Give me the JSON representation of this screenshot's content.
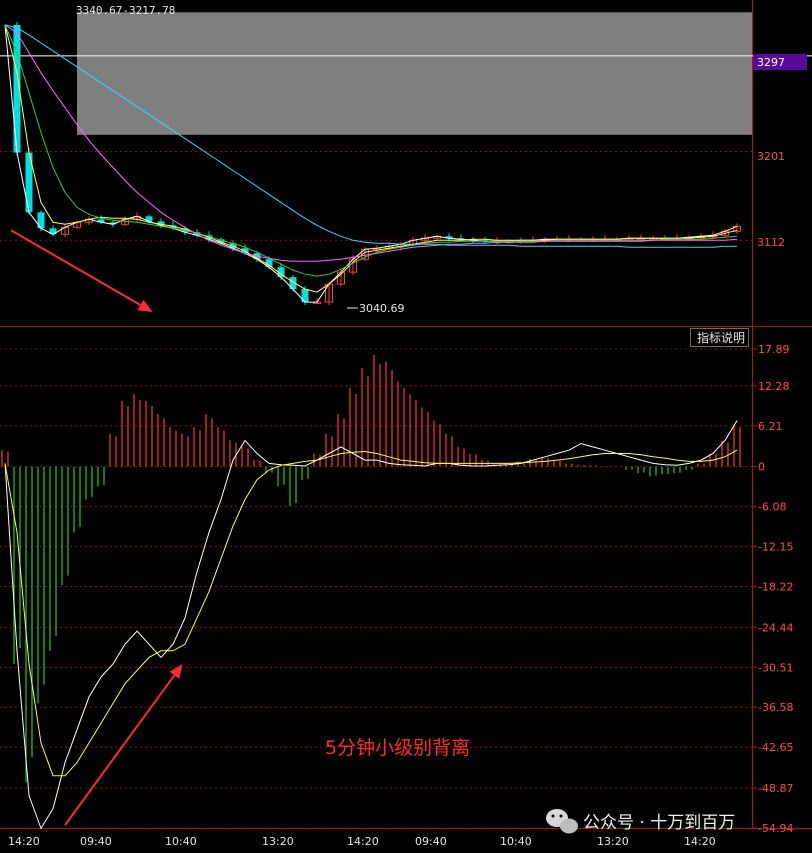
{
  "chart_data": [
    {
      "type": "candlestick",
      "range_label": "3340.67-3217.78",
      "price_marker": "3297",
      "low_label": "3040.69",
      "y_tick_labels": [
        "3201",
        "3112"
      ],
      "ylim": [
        3030,
        3345
      ],
      "highlight_zone": [
        3217.78,
        3340.67
      ],
      "marked_price": 3297,
      "series": [
        {
          "name": "",
          "color": "#ffffff",
          "values": [
            3328,
            3200,
            3140,
            3124,
            3118,
            3125,
            3130,
            3133,
            3130,
            3128,
            3133,
            3136,
            3131,
            3127,
            3124,
            3120,
            3117,
            3113,
            3109,
            3104,
            3099,
            3093,
            3085,
            3075,
            3063,
            3050,
            3050,
            3068,
            3080,
            3093,
            3103,
            3104,
            3106,
            3108,
            3112,
            3114,
            3116,
            3114,
            3113,
            3112,
            3111,
            3111,
            3111,
            3112,
            3112,
            3113,
            3113,
            3113,
            3113,
            3113,
            3113,
            3113,
            3114,
            3114,
            3114,
            3114,
            3114,
            3115,
            3116,
            3117,
            3121,
            3126
          ]
        },
        {
          "name": "",
          "color": "#ffff40",
          "values": [
            3328,
            3280,
            3200,
            3150,
            3130,
            3128,
            3130,
            3133,
            3135,
            3134,
            3134,
            3133,
            3130,
            3128,
            3126,
            3123,
            3119,
            3115,
            3110,
            3106,
            3101,
            3094,
            3087,
            3078,
            3070,
            3063,
            3060,
            3068,
            3078,
            3090,
            3100,
            3102,
            3104,
            3106,
            3108,
            3110,
            3112,
            3112,
            3112,
            3113,
            3113,
            3112,
            3112,
            3112,
            3112,
            3112,
            3113,
            3113,
            3113,
            3113,
            3113,
            3113,
            3114,
            3114,
            3114,
            3114,
            3114,
            3114,
            3115,
            3116,
            3119,
            3122
          ]
        },
        {
          "name": "",
          "color": "#33cc33",
          "values": [
            3328,
            3300,
            3260,
            3220,
            3185,
            3160,
            3145,
            3138,
            3134,
            3132,
            3131,
            3130,
            3128,
            3126,
            3124,
            3122,
            3119,
            3116,
            3112,
            3109,
            3105,
            3100,
            3094,
            3088,
            3082,
            3078,
            3076,
            3078,
            3083,
            3089,
            3095,
            3100,
            3103,
            3105,
            3107,
            3109,
            3110,
            3110,
            3111,
            3111,
            3111,
            3111,
            3111,
            3111,
            3111,
            3111,
            3112,
            3112,
            3112,
            3112,
            3112,
            3112,
            3112,
            3112,
            3112,
            3113,
            3113,
            3113,
            3113,
            3114,
            3115,
            3116
          ]
        },
        {
          "name": "",
          "color": "#ff66ff",
          "values": [
            3328,
            3320,
            3300,
            3280,
            3262,
            3245,
            3228,
            3212,
            3198,
            3185,
            3172,
            3160,
            3150,
            3140,
            3132,
            3125,
            3118,
            3112,
            3107,
            3103,
            3099,
            3096,
            3094,
            3092,
            3091,
            3091,
            3091,
            3092,
            3093,
            3095,
            3097,
            3099,
            3101,
            3103,
            3105,
            3106,
            3107,
            3108,
            3108,
            3109,
            3109,
            3110,
            3110,
            3110,
            3110,
            3111,
            3111,
            3111,
            3111,
            3111,
            3111,
            3111,
            3111,
            3111,
            3112,
            3112,
            3112,
            3112,
            3112,
            3112,
            3112,
            3113
          ]
        },
        {
          "name": "",
          "color": "#33d6ff",
          "values": [
            3328,
            3325,
            3318,
            3310,
            3302,
            3294,
            3286,
            3278,
            3270,
            3262,
            3254,
            3246,
            3238,
            3230,
            3222,
            3214,
            3206,
            3198,
            3190,
            3182,
            3174,
            3166,
            3158,
            3150,
            3142,
            3134,
            3127,
            3121,
            3116,
            3112,
            3110,
            3109,
            3109,
            3108,
            3108,
            3108,
            3108,
            3107,
            3107,
            3107,
            3107,
            3107,
            3107,
            3106,
            3106,
            3106,
            3106,
            3106,
            3106,
            3106,
            3106,
            3106,
            3105,
            3105,
            3105,
            3105,
            3105,
            3105,
            3105,
            3105,
            3106,
            3106
          ]
        }
      ],
      "annotations": [
        {
          "type": "arrow",
          "color": "#ff2a2a",
          "from": [
            0.5,
            3122
          ],
          "to": [
            12.3,
            3040
          ]
        }
      ]
    },
    {
      "type": "macd",
      "button_label": "指标说明",
      "y_tick_labels": [
        "17.89",
        "12.28",
        "6.21",
        "0",
        "-6.08",
        "-12.15",
        "-18.22",
        "-24.44",
        "-30.51",
        "-36.58",
        "-42.65",
        "-48.87",
        "-54.94"
      ],
      "ylim": [
        -54.94,
        17.89
      ],
      "histogram": [
        2.5,
        -30,
        -48,
        -36,
        -28,
        -18,
        -10,
        -5,
        -3,
        5,
        10,
        11,
        10,
        8,
        6,
        5,
        6,
        8,
        6,
        4,
        3,
        1,
        -1,
        -3,
        -6,
        -2,
        2,
        5,
        8,
        12,
        15,
        17,
        16,
        13,
        11,
        9,
        7,
        5,
        3,
        2,
        1,
        0.5,
        0.5,
        0.8,
        1.2,
        1.5,
        1,
        0.5,
        0.3,
        0.2,
        0.1,
        0,
        -0.5,
        -1,
        -1.5,
        -1.2,
        -1,
        -0.5,
        0.5,
        2,
        4,
        6.5
      ],
      "series": [
        {
          "name": "",
          "color": "#ffffff",
          "values": [
            0.5,
            -28,
            -50,
            -55,
            -52,
            -45,
            -40,
            -35,
            -32,
            -30,
            -27,
            -25,
            -27,
            -29,
            -27,
            -23,
            -16,
            -10,
            -5,
            1,
            4,
            2,
            0.5,
            0.3,
            0.2,
            0.1,
            1,
            2,
            3,
            2,
            1,
            1,
            0.5,
            0.3,
            0.2,
            0.1,
            0.5,
            0.5,
            0.2,
            0.1,
            0.1,
            0.2,
            0.3,
            0.5,
            1,
            1.5,
            2,
            2.5,
            3.5,
            3,
            2.5,
            2,
            1.5,
            1,
            0.5,
            0.3,
            0.2,
            0.5,
            1,
            2,
            4,
            7
          ]
        },
        {
          "name": "",
          "color": "#ffff40",
          "values": [
            0.5,
            -10,
            -30,
            -42,
            -47,
            -47,
            -45,
            -42,
            -39,
            -36,
            -33,
            -31,
            -29,
            -28,
            -28,
            -27,
            -23,
            -19,
            -14,
            -9,
            -5,
            -2,
            -0.5,
            0.2,
            0.5,
            0.8,
            1,
            1.5,
            2,
            2.2,
            2.3,
            2,
            1.5,
            1,
            0.8,
            0.6,
            0.5,
            0.5,
            0.5,
            0.5,
            0.5,
            0.5,
            0.5,
            0.6,
            0.7,
            0.8,
            1,
            1.2,
            1.5,
            1.8,
            2,
            2,
            2,
            1.8,
            1.5,
            1.3,
            1,
            0.8,
            0.8,
            1,
            1.5,
            2.5
          ]
        }
      ],
      "annotations": [
        {
          "type": "arrow",
          "color": "#ff2a2a",
          "from": [
            5,
            -54.5
          ],
          "to": [
            14.8,
            -30
          ]
        },
        {
          "type": "text",
          "color": "#ff2a2a",
          "text": "5分钟小级别背离"
        }
      ]
    }
  ],
  "time_axis": {
    "labels": [
      "14:20",
      "09:40",
      "10:40",
      "13:20",
      "14:20",
      "09:40",
      "10:40",
      "13:20",
      "14:20"
    ]
  },
  "colors": {
    "up": "#ff3b3b",
    "down": "#00e0e0",
    "hist_up": "#ff3b3b",
    "hist_down": "#22cc22",
    "grid": "#8a1010",
    "marker_bg": "#5a0a9a"
  },
  "watermark": {
    "text": "公众号 · 十万到百万",
    "icon": "wechat-icon"
  }
}
